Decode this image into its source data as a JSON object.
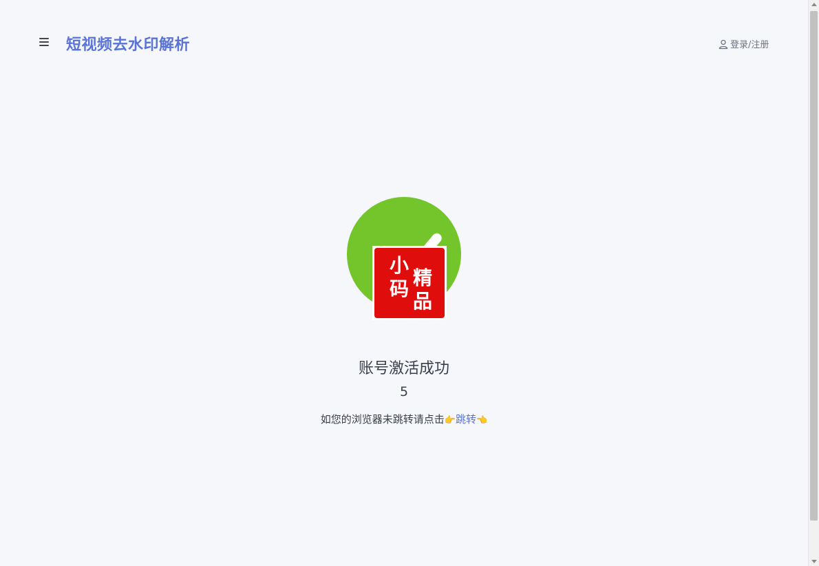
{
  "header": {
    "site_title": "短视频去水印解析",
    "login_label": "登录/注册"
  },
  "icons": {
    "menu": "hamburger-icon",
    "user": "user-icon",
    "success": "check-icon",
    "seal": "seal-logo"
  },
  "seal": {
    "chars": [
      "小",
      "码",
      "精",
      "品"
    ]
  },
  "status": {
    "title": "账号激活成功",
    "countdown": "5",
    "redirect_prefix": "如您的浏览器未跳转请点击",
    "redirect_left_hand": "👉",
    "redirect_link": "跳转",
    "redirect_right_hand": "👈"
  },
  "colors": {
    "brand": "#5a73d6",
    "success": "#74c42c",
    "seal_red": "#e00d0d"
  }
}
